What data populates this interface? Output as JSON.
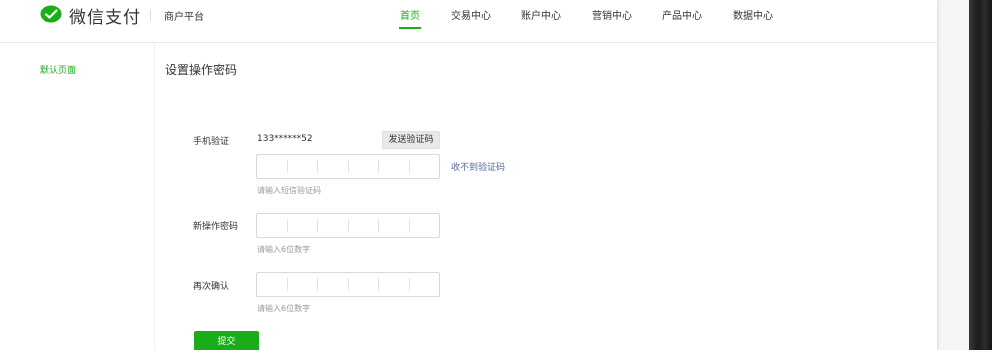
{
  "header": {
    "brand": "微信支付",
    "platform": "商户平台",
    "nav": [
      {
        "label": "首页",
        "active": true
      },
      {
        "label": "交易中心",
        "active": false
      },
      {
        "label": "账户中心",
        "active": false
      },
      {
        "label": "营销中心",
        "active": false
      },
      {
        "label": "产品中心",
        "active": false
      },
      {
        "label": "数据中心",
        "active": false
      }
    ]
  },
  "sidebar": {
    "items": [
      {
        "label": "默认页面",
        "active": true
      }
    ]
  },
  "main": {
    "title": "设置操作密码",
    "phone_verify": {
      "label": "手机验证",
      "phone": "133******52",
      "send_button": "发送验证码",
      "resend_link": "收不到验证码",
      "code_hint": "请输入短信验证码",
      "digits": 6
    },
    "new_password": {
      "label": "新操作密码",
      "hint": "请输入6位数字",
      "digits": 6
    },
    "confirm_password": {
      "label": "再次确认",
      "hint": "请输入6位数字",
      "digits": 6
    },
    "submit_button": "提交"
  },
  "colors": {
    "accent": "#1aad19",
    "link": "#576b95",
    "hint": "#999999"
  },
  "icons": {
    "logo": "wechat-pay-logo-icon"
  }
}
